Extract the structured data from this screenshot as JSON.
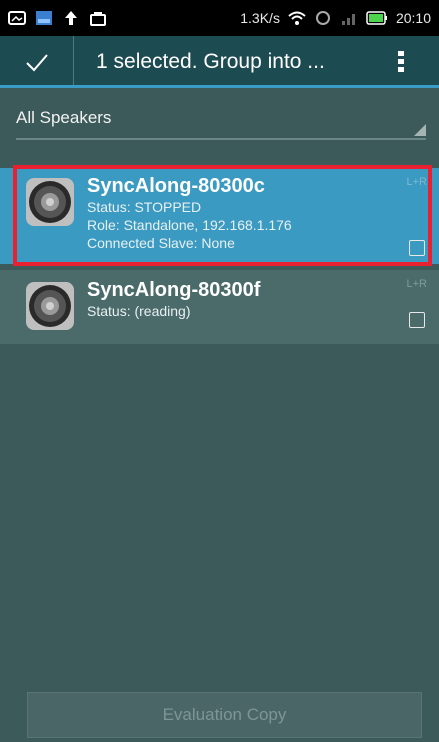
{
  "status_bar": {
    "network_speed": "1.3K/s",
    "time": "20:10"
  },
  "action_bar": {
    "title": "1 selected. Group into ..."
  },
  "filter": {
    "selected": "All Speakers"
  },
  "speakers": [
    {
      "name": "SyncAlong-80300c",
      "status": "Status: STOPPED",
      "role": "Role: Standalone,  192.168.1.176",
      "slave": "Connected Slave: None",
      "channel": "L+R",
      "selected": true
    },
    {
      "name": "SyncAlong-80300f",
      "status": "Status: (reading)",
      "channel": "L+R",
      "selected": false
    }
  ],
  "footer": {
    "button_label": "Evaluation Copy"
  },
  "colors": {
    "action_bar": "#1d4b52",
    "accent": "#3a9cc4",
    "selected_row": "#3b9ac2",
    "highlight": "#e82030",
    "background": "#3c5a5a"
  }
}
